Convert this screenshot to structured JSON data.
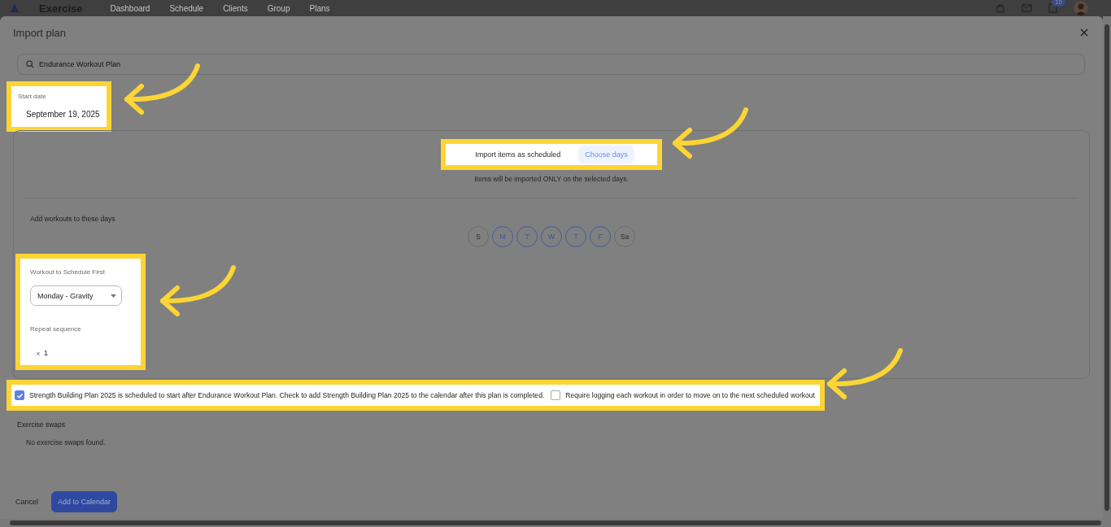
{
  "nav": {
    "brand": "Exercise",
    "links": [
      "Dashboard",
      "Schedule",
      "Clients",
      "Group",
      "Plans"
    ],
    "badge": "10"
  },
  "dialog": {
    "title": "Import plan",
    "search": {
      "value": "Endurance Workout Plan"
    },
    "start_date": {
      "label": "Start date",
      "value": "September 19, 2025"
    },
    "schedule_modes": [
      {
        "label": "Import items as scheduled",
        "selected": false
      },
      {
        "label": "Choose days",
        "selected": true
      }
    ],
    "note": "Items will be imported ONLY on the selected days.",
    "days_label": "Add workouts to these days",
    "days": [
      {
        "label": "S",
        "selected": false
      },
      {
        "label": "M",
        "selected": true
      },
      {
        "label": "T",
        "selected": true
      },
      {
        "label": "W",
        "selected": true
      },
      {
        "label": "T",
        "selected": true
      },
      {
        "label": "F",
        "selected": true
      },
      {
        "label": "Sa",
        "selected": false
      }
    ],
    "first_workout": {
      "label": "Workout to Schedule First",
      "value": "Monday - Gravity"
    },
    "repeat": {
      "label": "Repeat sequence",
      "prefix": "x",
      "value": "1"
    },
    "options": [
      {
        "label": "Strength Building Plan 2025 is scheduled to start after Endurance Workout Plan. Check to add Strength Building Plan 2025 to the calendar after this plan is completed.",
        "checked": true
      },
      {
        "label": "Require logging each workout in order to move on to the next scheduled workout",
        "checked": false
      }
    ],
    "swaps": {
      "label": "Exercise swaps",
      "empty": "No exercise swaps found."
    },
    "buttons": [
      {
        "label": "Cancel",
        "kind": "text"
      },
      {
        "label": "Add to Calendar",
        "kind": "primary"
      }
    ]
  }
}
